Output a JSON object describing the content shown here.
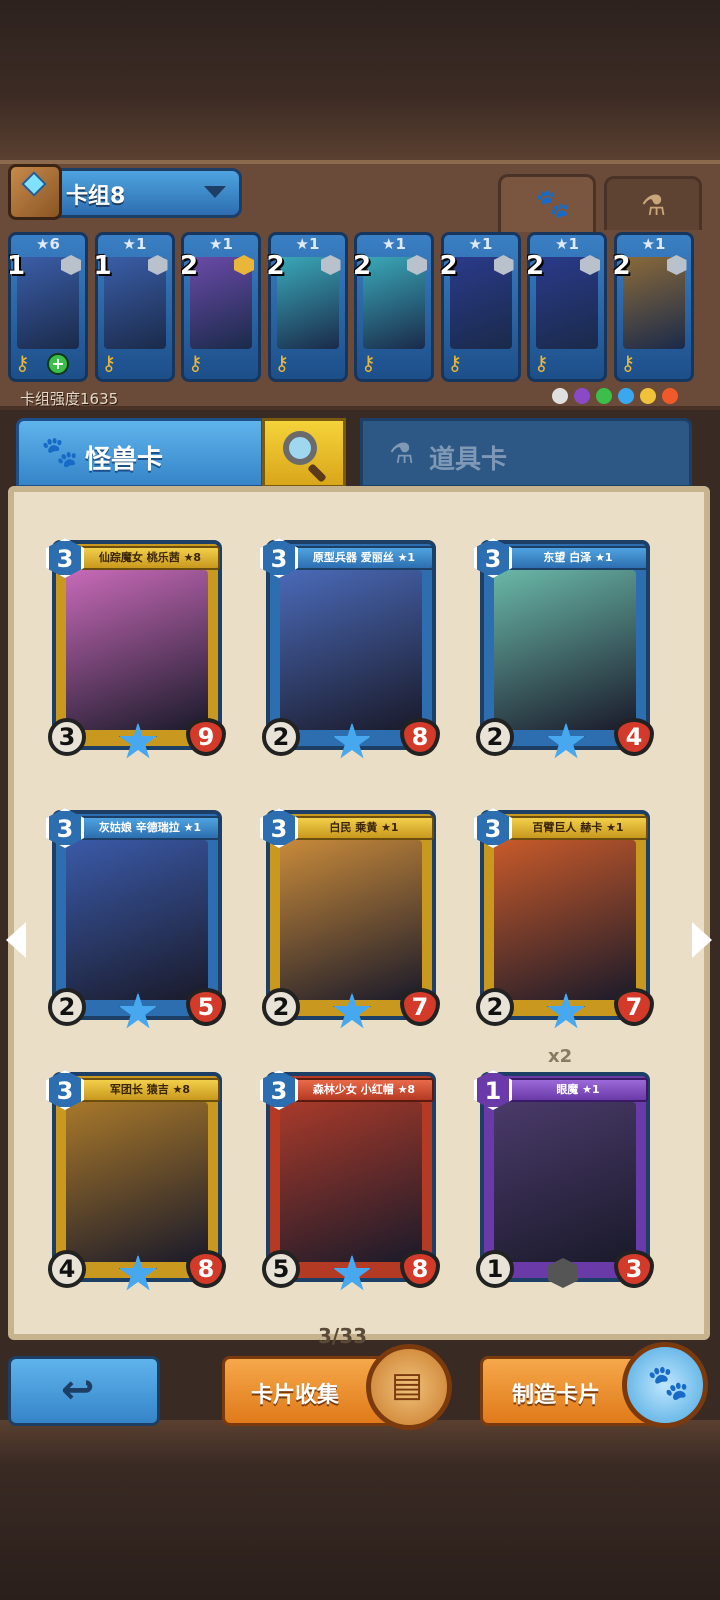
{
  "deck": {
    "name": "卡组8",
    "power_label": "卡组强度1635",
    "tabs": {
      "monster_icon": "paw-icon",
      "item_icon": "flask-icon"
    },
    "cards": [
      {
        "cost": "1",
        "stars": "★6",
        "badge": "silver",
        "plus": true,
        "color": "#3b5ea8"
      },
      {
        "cost": "1",
        "stars": "★1",
        "badge": "silver",
        "plus": false,
        "color": "#3b5ea8"
      },
      {
        "cost": "2",
        "stars": "★1",
        "badge": "gold",
        "plus": false,
        "color": "#6a4aa8"
      },
      {
        "cost": "2",
        "stars": "★1",
        "badge": "silver",
        "plus": false,
        "color": "#3aa8b8"
      },
      {
        "cost": "2",
        "stars": "★1",
        "badge": "silver",
        "plus": false,
        "color": "#3aa8b8"
      },
      {
        "cost": "2",
        "stars": "★1",
        "badge": "silver",
        "plus": false,
        "color": "#2a3a8a"
      },
      {
        "cost": "2",
        "stars": "★1",
        "badge": "silver",
        "plus": false,
        "color": "#2a3a8a"
      },
      {
        "cost": "2",
        "stars": "★1",
        "badge": "silver",
        "plus": false,
        "color": "#8a6a3a"
      }
    ],
    "elements": [
      "#e0e0e0",
      "#8a4ac8",
      "#3cbf4a",
      "#3aa8f0",
      "#f0c23a",
      "#f05a2a"
    ]
  },
  "categories": {
    "monster_label": "怪兽卡",
    "item_label": "道具卡"
  },
  "cards": [
    {
      "title": "仙踪魔女 桃乐茜 ★8",
      "cost": "3",
      "atk": "3",
      "hp": "9",
      "style": "gold",
      "art": "#c86ab8",
      "center": "star",
      "copies": ""
    },
    {
      "title": "原型兵器 爱丽丝 ★1",
      "cost": "3",
      "atk": "2",
      "hp": "8",
      "style": "blue",
      "art": "#4a6ab8",
      "center": "star",
      "copies": ""
    },
    {
      "title": "东望 白泽 ★1",
      "cost": "3",
      "atk": "2",
      "hp": "4",
      "style": "blue",
      "art": "#6ab8a8",
      "center": "star",
      "copies": ""
    },
    {
      "title": "灰姑娘 辛德瑞拉 ★1",
      "cost": "3",
      "atk": "2",
      "hp": "5",
      "style": "blue",
      "art": "#3a5aa8",
      "center": "star",
      "copies": ""
    },
    {
      "title": "白民 乘黄 ★1",
      "cost": "3",
      "atk": "2",
      "hp": "7",
      "style": "gold",
      "art": "#c88a3a",
      "center": "star",
      "copies": ""
    },
    {
      "title": "百臂巨人 赫卡 ★1",
      "cost": "3",
      "atk": "2",
      "hp": "7",
      "style": "gold",
      "art": "#c85a2a",
      "center": "star",
      "copies": ""
    },
    {
      "title": "军团长 猿吉 ★8",
      "cost": "3",
      "atk": "4",
      "hp": "8",
      "style": "gold",
      "art": "#a8782a",
      "center": "star",
      "copies": ""
    },
    {
      "title": "森林少女 小红帽 ★8",
      "cost": "3",
      "atk": "5",
      "hp": "8",
      "style": "red",
      "art": "#a83a2a",
      "center": "star",
      "copies": ""
    },
    {
      "title": "眼魔 ★1",
      "cost": "1",
      "atk": "1",
      "hp": "3",
      "style": "purple",
      "art": "#4a3a6a",
      "center": "gem",
      "copies": "x2"
    }
  ],
  "pagination": {
    "label": "3/33"
  },
  "buttons": {
    "back_icon": "back-arrow-icon",
    "collect_label": "卡片收集",
    "make_label": "制造卡片"
  }
}
